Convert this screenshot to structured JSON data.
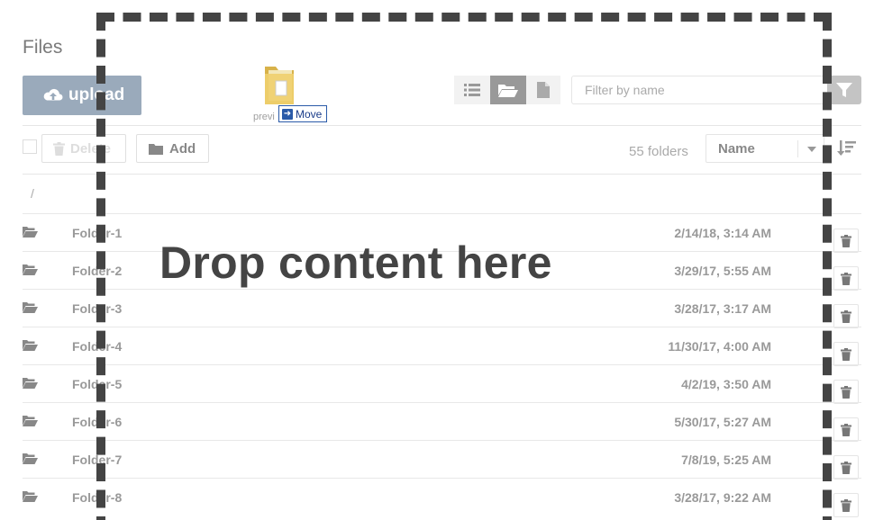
{
  "header": {
    "title": "Files"
  },
  "toolbar": {
    "upload_label": "upload",
    "filter_placeholder": "Filter by name",
    "view_buttons": [
      "list-view-icon",
      "folder-view-icon",
      "file-view-icon"
    ],
    "active_view": "folder-view-icon"
  },
  "actions": {
    "delete_label": "Delete",
    "add_label": "Add",
    "folder_count": "55 folders",
    "sort_value": "Name"
  },
  "breadcrumb": "/",
  "rows": [
    {
      "name": "Folder-1",
      "date": "2/14/18, 3:14 AM"
    },
    {
      "name": "Folder-2",
      "date": "3/29/17, 5:55 AM"
    },
    {
      "name": "Folder-3",
      "date": "3/28/17, 3:17 AM"
    },
    {
      "name": "Folder-4",
      "date": "11/30/17, 4:00 AM"
    },
    {
      "name": "Folder-5",
      "date": "4/2/19, 3:50 AM"
    },
    {
      "name": "Folder-6",
      "date": "5/30/17, 5:27 AM"
    },
    {
      "name": "Folder-7",
      "date": "7/8/19, 5:25 AM"
    },
    {
      "name": "Folder-8",
      "date": "3/28/17, 9:22 AM"
    }
  ],
  "dropzone": {
    "text": "Drop content here"
  },
  "drag_ghost": {
    "label": "previ",
    "badge": "Move"
  },
  "colors": {
    "upload_bg": "#9aaabb",
    "dropzone_border": "#444444",
    "move_badge": "#2a5aa8"
  }
}
